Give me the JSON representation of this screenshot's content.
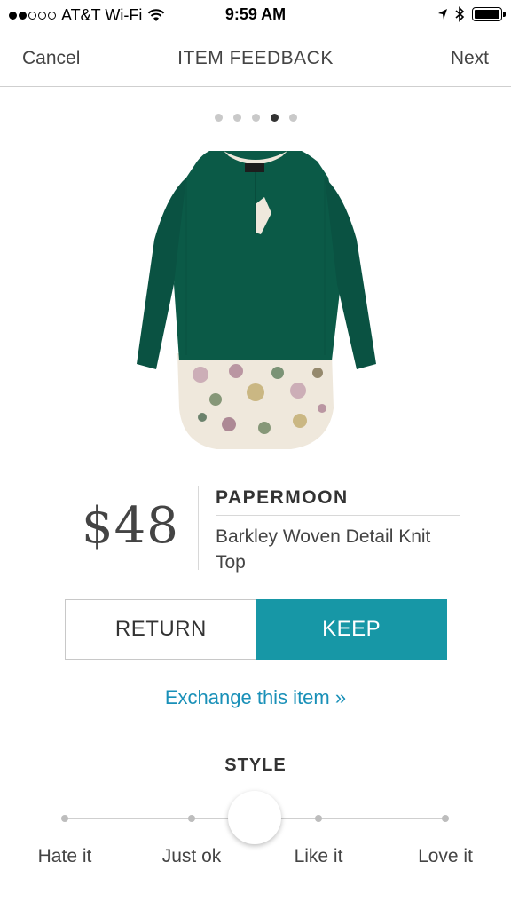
{
  "status_bar": {
    "carrier": "AT&T Wi-Fi",
    "signal_bars": 2,
    "signal_total": 5,
    "time": "9:59 AM",
    "battery_level": 1.0,
    "icons": [
      "wifi-icon",
      "location-arrow-icon",
      "bluetooth-icon",
      "battery-icon"
    ]
  },
  "nav": {
    "left": "Cancel",
    "title": "ITEM FEEDBACK",
    "right": "Next"
  },
  "pager": {
    "total": 5,
    "active_index": 3
  },
  "product": {
    "price": "$48",
    "brand": "PAPERMOON",
    "name": "Barkley Woven Detail Knit Top",
    "colors": {
      "body": "#0b5a47",
      "print": "#efe8dc"
    }
  },
  "actions": {
    "return_label": "RETURN",
    "keep_label": "KEEP",
    "selected": "keep",
    "accent_color": "#1797a6"
  },
  "exchange_link": "Exchange this item »",
  "style_rating": {
    "label": "STYLE",
    "options": [
      "Hate it",
      "Just ok",
      "Like it",
      "Love it"
    ],
    "value": null
  }
}
